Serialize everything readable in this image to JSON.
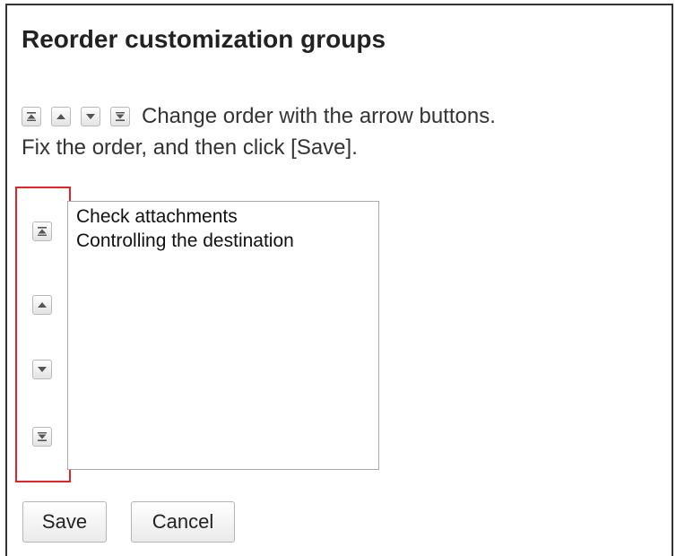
{
  "dialog": {
    "title": "Reorder customization groups",
    "instruction_line1": "Change order with the arrow buttons.",
    "instruction_line2": "Fix the order, and then click [Save]."
  },
  "icons": {
    "move_top": "move-to-top-icon",
    "move_up": "move-up-icon",
    "move_down": "move-down-icon",
    "move_bottom": "move-to-bottom-icon"
  },
  "groups": {
    "items": [
      "Check attachments",
      "Controlling the destination"
    ]
  },
  "actions": {
    "save_label": "Save",
    "cancel_label": "Cancel"
  },
  "colors": {
    "highlight_border": "#e8202a",
    "frame_border": "#333333",
    "icon_color": "#555555"
  }
}
